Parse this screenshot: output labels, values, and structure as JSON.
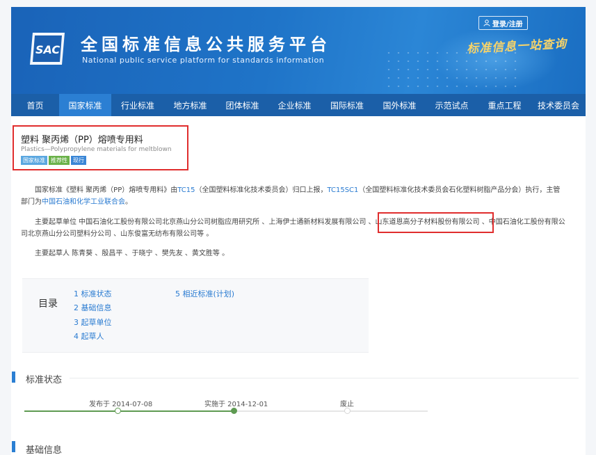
{
  "header": {
    "logo_text": "SAC",
    "title": "全国标准信息公共服务平台",
    "subtitle": "National public service platform  for standards information",
    "login_label": "登录/注册",
    "slogan": "标准信息一站查询"
  },
  "nav": {
    "items": [
      {
        "label": "首页",
        "active": false
      },
      {
        "label": "国家标准",
        "active": true
      },
      {
        "label": "行业标准",
        "active": false
      },
      {
        "label": "地方标准",
        "active": false
      },
      {
        "label": "团体标准",
        "active": false
      },
      {
        "label": "企业标准",
        "active": false
      },
      {
        "label": "国际标准",
        "active": false
      },
      {
        "label": "国外标准",
        "active": false
      },
      {
        "label": "示范试点",
        "active": false
      },
      {
        "label": "重点工程",
        "active": false
      },
      {
        "label": "技术委员会",
        "active": false
      }
    ]
  },
  "standard": {
    "title": "塑料 聚丙烯（PP）熔喷专用料",
    "title_en": "Plastics—Polypropylene materials for meltblown",
    "tags": [
      {
        "label": "国家标准",
        "color": "#5aa7e0"
      },
      {
        "label": "推荐性",
        "color": "#6bb24a"
      },
      {
        "label": "现行",
        "color": "#3a86d6"
      }
    ]
  },
  "description": {
    "p1_a": "国家标准《塑料 聚丙烯（PP）熔喷专用料》由",
    "p1_link1": "TC15",
    "p1_b": "（全国塑料标准化技术委员会）归口上报，",
    "p1_link2": "TC15SC1",
    "p1_c": "（全国塑料标准化技术委员会石化塑料树脂产品分会）执行，主管",
    "p1_d": "部门为",
    "p1_link3": "中国石油和化学工业联合会",
    "p1_e": "。",
    "p2_a": "主要起草单位 中国石油化工股份有限公司北京燕山分公司树脂应用研究所 、上海伊士通新材料发展有限公司 、",
    "p2_highlight": "山东道恩高分子材料股份有限公司",
    "p2_b": " 、中国石油化工股份有限公",
    "p2_c": "司北京燕山分公司塑料分公司 、山东俊富无纺布有限公司等 。",
    "p3": "主要起草人 陈青葵 、殷昌平 、于晓宁 、樊先友 、黄文胜等 。"
  },
  "toc": {
    "label": "目录",
    "links": [
      "1 标准状态",
      "2 基础信息",
      "3 起草单位",
      "4 起草人",
      "5 相近标准(计划)"
    ]
  },
  "status_section": {
    "title": "标准状态",
    "events": [
      {
        "label": "发布于 2014-07-08",
        "done": true
      },
      {
        "label": "实施于 2014-12-01",
        "done": true
      },
      {
        "label": "废止",
        "done": false
      }
    ]
  },
  "basic_section": {
    "title": "基础信息"
  }
}
